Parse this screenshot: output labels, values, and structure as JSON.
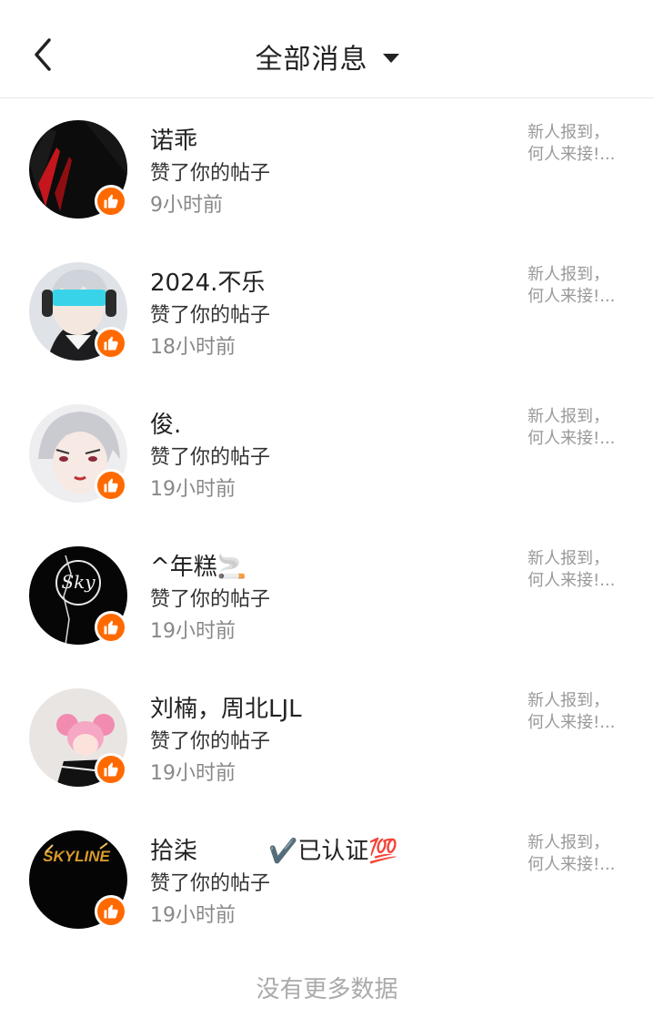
{
  "header": {
    "title": "全部消息",
    "back_icon": "chevron-left-icon",
    "dropdown_icon": "caret-down-icon"
  },
  "notifications": [
    {
      "name": "诺乖",
      "action": "赞了你的帖子",
      "time": "9小时前",
      "post_line1": "新人报到，",
      "post_line2": "何人来接!..."
    },
    {
      "name": "2024.不乐",
      "action": "赞了你的帖子",
      "time": "18小时前",
      "post_line1": "新人报到，",
      "post_line2": "何人来接!..."
    },
    {
      "name": "俊.",
      "action": "赞了你的帖子",
      "time": "19小时前",
      "post_line1": "新人报到，",
      "post_line2": "何人来接!..."
    },
    {
      "name": "^年糕🚬",
      "action": "赞了你的帖子",
      "time": "19小时前",
      "post_line1": "新人报到，",
      "post_line2": "何人来接!..."
    },
    {
      "name": "刘楠，周北LJL",
      "action": "赞了你的帖子",
      "time": "19小时前",
      "post_line1": "新人报到，",
      "post_line2": "何人来接!..."
    },
    {
      "name": "拾柒　　　✔️已认证💯",
      "action": "赞了你的帖子",
      "time": "19小时前",
      "post_line1": "新人报到，",
      "post_line2": "何人来接!..."
    }
  ],
  "avatar_labels": {
    "avatar_4": "Sky",
    "avatar_6": "SKYLINE"
  },
  "footer": {
    "text": "没有更多数据"
  },
  "colors": {
    "like_badge": "#ff6a00",
    "secondary_text": "#888888",
    "preview_text": "#999999"
  }
}
